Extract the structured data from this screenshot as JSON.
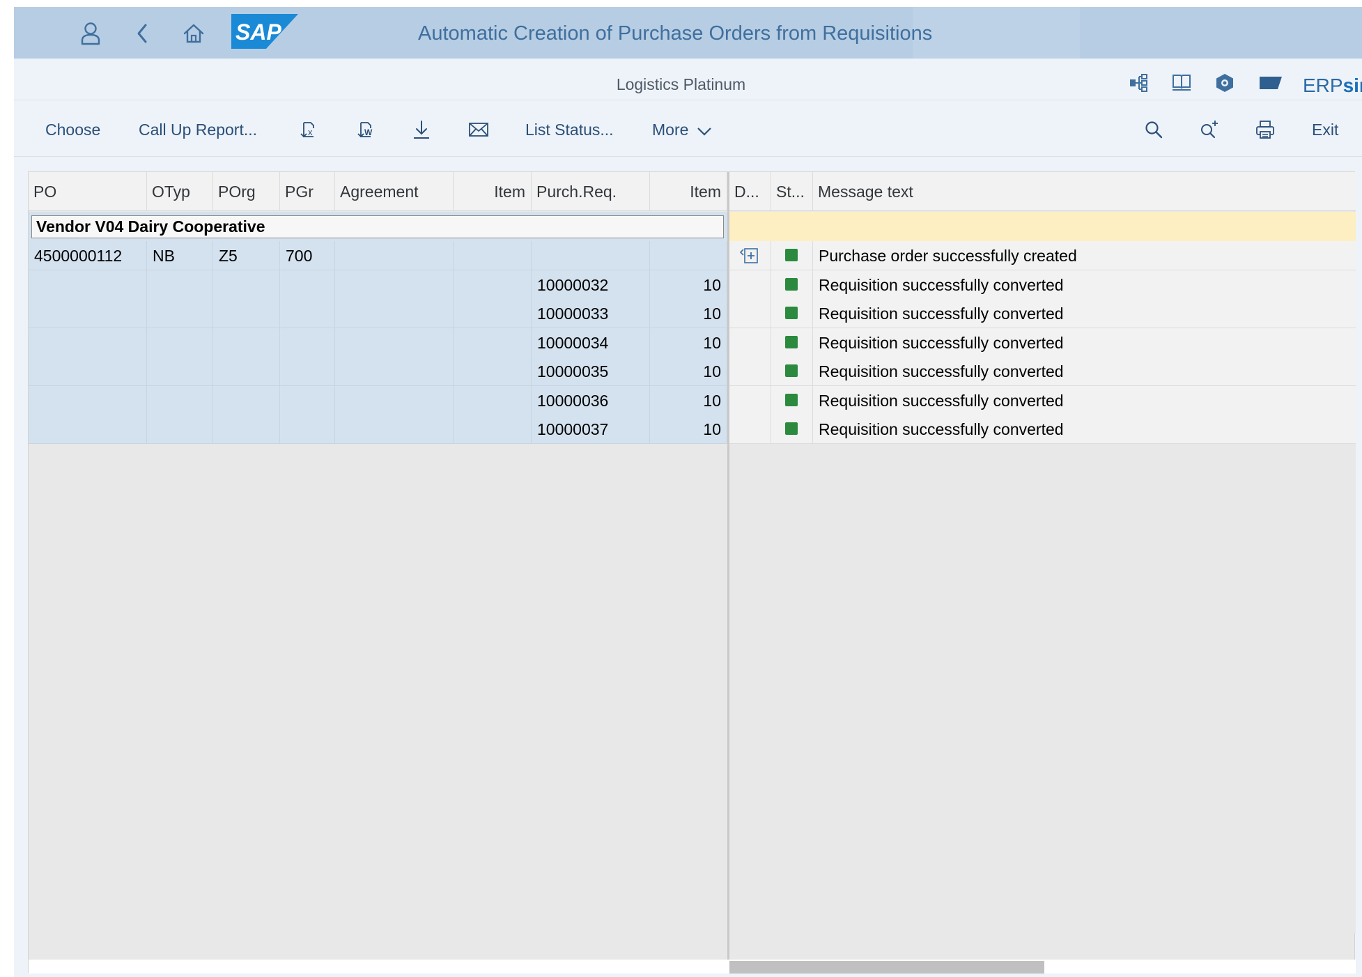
{
  "shell": {
    "title": "Automatic Creation of Purchase Orders from Requisitions",
    "logo_text": "SAP",
    "buttons": [
      "user-icon",
      "back-icon",
      "home-icon"
    ]
  },
  "subheader": {
    "title": "Logistics Platinum",
    "brand_prefix": "ERP",
    "brand_suffix": "sin",
    "icons": [
      "hierarchy-icon",
      "book-icon",
      "settings-hex-icon",
      "flag-icon"
    ]
  },
  "toolbar": {
    "choose": "Choose",
    "call_up_report": "Call Up Report...",
    "list_status": "List Status...",
    "more": "More",
    "exit": "Exit",
    "icons": [
      "export-excel-icon",
      "export-word-icon",
      "download-icon",
      "mail-icon",
      "search-icon",
      "search-next-icon",
      "print-icon"
    ]
  },
  "table": {
    "columns_left": [
      "PO",
      "OTyp",
      "POrg",
      "PGr",
      "Agreement",
      "Item",
      "Purch.Req.",
      "Item"
    ],
    "columns_right": [
      "D...",
      "St...",
      "Message text"
    ],
    "vendor_label": "Vendor V04 Dairy Cooperative",
    "rows": [
      {
        "po": "4500000112",
        "otyp": "NB",
        "porg": "Z5",
        "pgr": "700",
        "agreement": "",
        "item": "",
        "purch_req": "",
        "req_item": "",
        "detail": true,
        "status": "green",
        "message": "Purchase order successfully created"
      },
      {
        "po": "",
        "otyp": "",
        "porg": "",
        "pgr": "",
        "agreement": "",
        "item": "",
        "purch_req": "10000032",
        "req_item": "10",
        "detail": false,
        "status": "green",
        "message": "Requisition successfully converted"
      },
      {
        "po": "",
        "otyp": "",
        "porg": "",
        "pgr": "",
        "agreement": "",
        "item": "",
        "purch_req": "10000033",
        "req_item": "10",
        "detail": false,
        "status": "green",
        "message": "Requisition successfully converted"
      },
      {
        "po": "",
        "otyp": "",
        "porg": "",
        "pgr": "",
        "agreement": "",
        "item": "",
        "purch_req": "10000034",
        "req_item": "10",
        "detail": false,
        "status": "green",
        "message": "Requisition successfully converted"
      },
      {
        "po": "",
        "otyp": "",
        "porg": "",
        "pgr": "",
        "agreement": "",
        "item": "",
        "purch_req": "10000035",
        "req_item": "10",
        "detail": false,
        "status": "green",
        "message": "Requisition successfully converted"
      },
      {
        "po": "",
        "otyp": "",
        "porg": "",
        "pgr": "",
        "agreement": "",
        "item": "",
        "purch_req": "10000036",
        "req_item": "10",
        "detail": false,
        "status": "green",
        "message": "Requisition successfully converted"
      },
      {
        "po": "",
        "otyp": "",
        "porg": "",
        "pgr": "",
        "agreement": "",
        "item": "",
        "purch_req": "10000037",
        "req_item": "10",
        "detail": false,
        "status": "green",
        "message": "Requisition successfully converted"
      }
    ]
  },
  "colors": {
    "shell_bg": "#b7cde3",
    "title_color": "#3f6f9e",
    "row_blue": "#d4e1ee",
    "vendor_highlight": "#fdefc2",
    "status_green": "#2b8a3e",
    "link_blue": "#2a4f78"
  }
}
